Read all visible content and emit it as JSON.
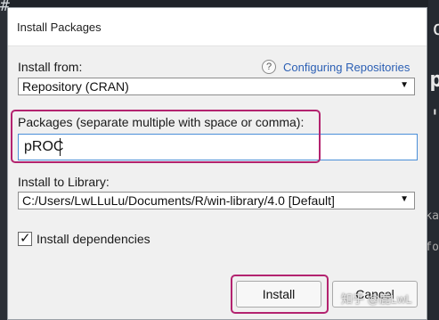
{
  "background": {
    "hash": "#",
    "right_fragments": [
      "o",
      "p",
      "'",
      "ka",
      "fo"
    ]
  },
  "dialog": {
    "title": "Install Packages",
    "install_from": {
      "label": "Install from:",
      "help_icon": "?",
      "help_link": "Configuring Repositories",
      "selected": "Repository (CRAN)"
    },
    "packages": {
      "label": "Packages (separate multiple with space or comma):",
      "value": "pROC"
    },
    "library": {
      "label": "Install to Library:",
      "selected": "C:/Users/LwLLuLu/Documents/R/win-library/4.0 [Default]"
    },
    "dependencies": {
      "label": "Install dependencies",
      "checked": true
    },
    "buttons": {
      "install": "Install",
      "cancel": "Cancel"
    },
    "highlight_color": "#b3236f"
  },
  "watermark": "知乎 @鹿LwL"
}
